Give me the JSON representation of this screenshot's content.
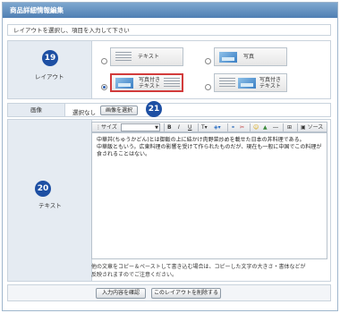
{
  "header": {
    "title": "商品詳細情報編集"
  },
  "intro": {
    "text": "レイアウトを選択し、項目を入力して下さい"
  },
  "layout": {
    "label": "レイアウト",
    "badge": "19",
    "options": [
      {
        "label": "テキスト",
        "selected": false
      },
      {
        "label": "写真",
        "selected": false
      },
      {
        "label": "写真付き\nテキスト",
        "selected": true
      },
      {
        "label": "写真付き\nテキスト",
        "selected": false
      }
    ]
  },
  "image": {
    "label": "画像",
    "status": "選択なし",
    "select_button": "画像を選択",
    "badge": "21"
  },
  "text": {
    "label": "テキスト",
    "badge": "20",
    "toolbar": {
      "size_label": "サイズ",
      "bold": "B",
      "italic": "I",
      "underline": "U",
      "source": "ソース"
    },
    "content_line1": "中華丼(ちゅうかどん)とは御飯の上に結かけ肉野菜炒めを載せた日本の丼料理である。",
    "content_line2": "中華飯ともいう。広東料理の影響を受けて作られたものだが、現在も一般に中国でこの料理が食されることはない。",
    "help_line1": "他の文章をコピー＆ペーストして書き込む場合は、コピーした文字の大きさ・書体などが",
    "help_line2": "反映されますのでご注意ください。"
  },
  "actions": {
    "confirm_button": "入力内容を確認",
    "delete_button": "このレイアウトを削除する"
  },
  "colors": {
    "header_bg": "#5b88b9",
    "label_bg": "#e5ebf2",
    "badge": "#1d4fa3",
    "selected_border": "#d23b3b"
  }
}
